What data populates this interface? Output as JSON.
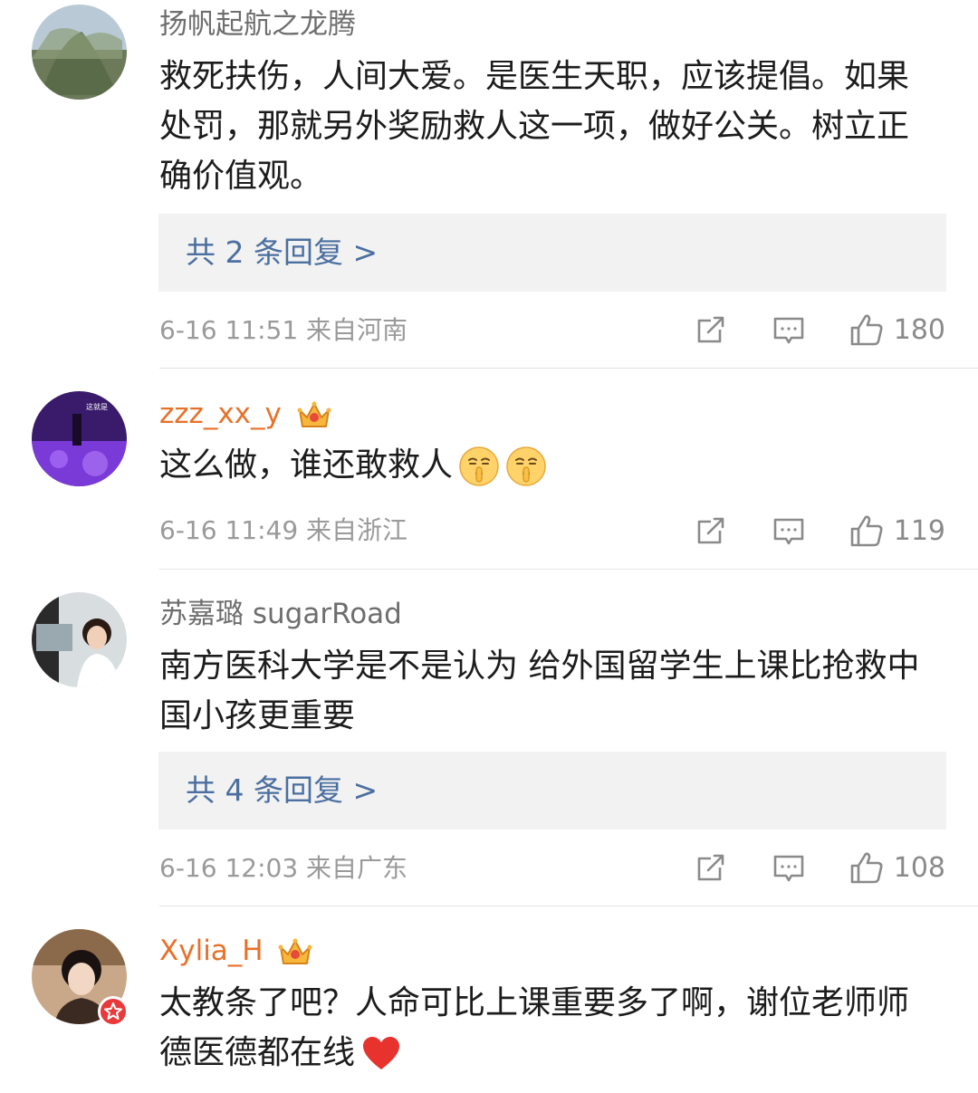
{
  "colors": {
    "link_blue": "#4a6fa0",
    "vip_orange": "#e8712a",
    "meta_gray": "#9a9a9a",
    "heart_red": "#e8322e"
  },
  "comments": [
    {
      "username": "扬帆起航之龙腾",
      "text": "救死扶伤，人间大爱。是医生天职，应该提倡。如果处罚，那就另外奖励救人这一项，做好公关。树立正确价值观。",
      "reply_link": "共 2 条回复 >",
      "meta": "6-16 11:51  来自河南",
      "likes": "180",
      "icons": [
        "share-icon",
        "comment-icon",
        "thumbs-up-icon"
      ]
    },
    {
      "username": "zzz_xx_y",
      "text": "这么做，谁还敢救人",
      "emoji": [
        "shush-face-emoji",
        "shush-face-emoji"
      ],
      "meta": "6-16 11:49  来自浙江",
      "likes": "119",
      "icons": [
        "crown-icon",
        "share-icon",
        "comment-icon",
        "thumbs-up-icon"
      ]
    },
    {
      "username": "苏嘉璐 sugarRoad",
      "text": "南方医科大学是不是认为 给外国留学生上课比抢救中国小孩更重要",
      "reply_link": "共 4 条回复 >",
      "meta": "6-16 12:03  来自广东",
      "likes": "108",
      "icons": [
        "share-icon",
        "comment-icon",
        "thumbs-up-icon"
      ]
    },
    {
      "username": "Xylia_H",
      "text": "太教条了吧？人命可比上课重要多了啊，谢位老师师德医德都在线",
      "emoji": [
        "red-heart-emoji"
      ],
      "icons": [
        "crown-icon",
        "star-badge-icon"
      ]
    }
  ]
}
